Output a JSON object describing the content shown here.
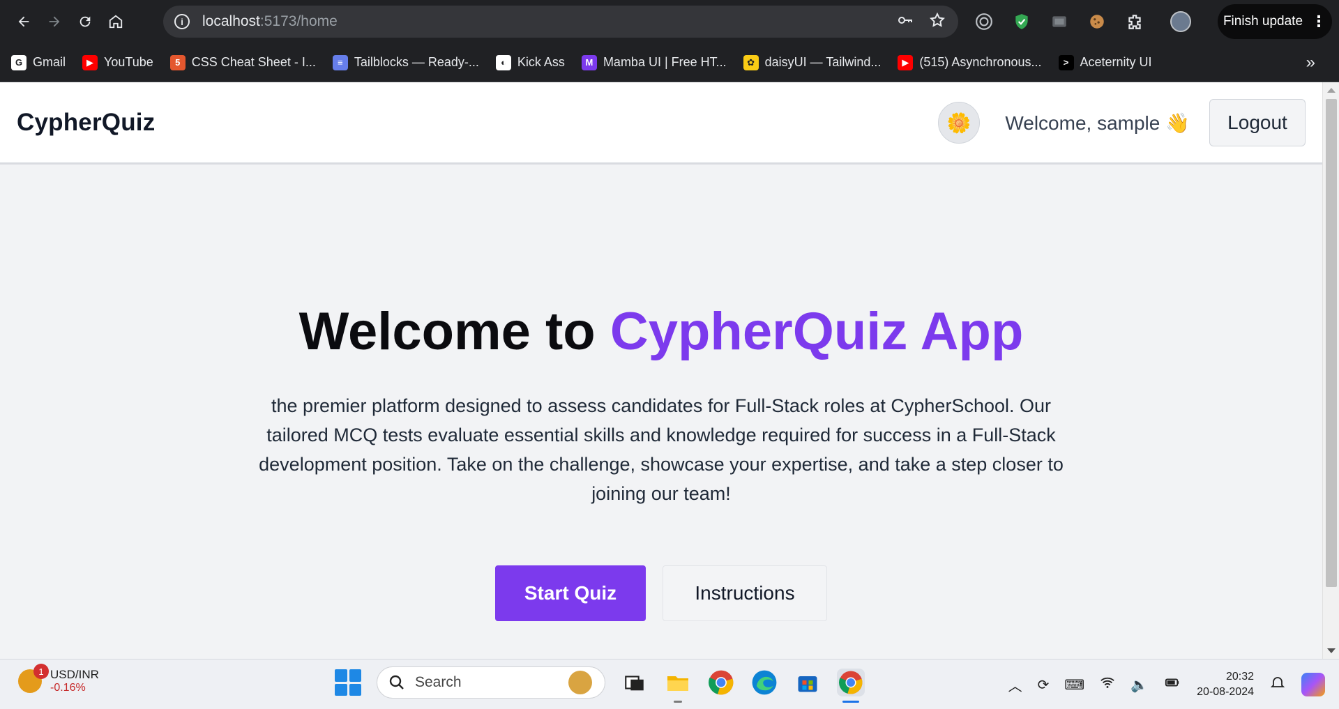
{
  "browser": {
    "url_host": "localhost",
    "url_path": ":5173/home",
    "finish_update_label": "Finish update",
    "bookmarks": [
      {
        "label": "Gmail",
        "icon": "google-icon",
        "color": "#ffffff"
      },
      {
        "label": "YouTube",
        "icon": "youtube-icon",
        "color": "#ff0000"
      },
      {
        "label": "CSS Cheat Sheet - I...",
        "icon": "html-icon",
        "color": "#e4572e"
      },
      {
        "label": "Tailblocks — Ready-...",
        "icon": "tailblocks-icon",
        "color": "#667eea"
      },
      {
        "label": "Kick Ass",
        "icon": "globe-icon",
        "color": "#ffffff"
      },
      {
        "label": "Mamba UI | Free HT...",
        "icon": "mamba-icon",
        "color": "#7c3aed"
      },
      {
        "label": "daisyUI — Tailwind...",
        "icon": "daisy-icon",
        "color": "#facc15"
      },
      {
        "label": "(515) Asynchronous...",
        "icon": "youtube-icon",
        "color": "#ff0000"
      },
      {
        "label": "Aceternity UI",
        "icon": "aceternity-icon",
        "color": "#000000"
      }
    ]
  },
  "app": {
    "brand": "CypherQuiz",
    "welcome_user": "Welcome, sample 👋",
    "logout_label": "Logout",
    "hero": {
      "title_prefix": "Welcome to ",
      "title_accent": "CypherQuiz App",
      "description": "the premier platform designed to assess candidates for Full-Stack roles at CypherSchool. Our tailored MCQ tests evaluate essential skills and knowledge required for success in a Full-Stack development position. Take on the challenge, showcase your expertise, and take a step closer to joining our team!",
      "start_label": "Start Quiz",
      "instructions_label": "Instructions"
    },
    "accent_color": "#7c3aed"
  },
  "taskbar": {
    "ticker_pair": "USD/INR",
    "ticker_change": "-0.16%",
    "ticker_badge": "1",
    "search_label": "Search",
    "time": "20:32",
    "date": "20-08-2024"
  }
}
